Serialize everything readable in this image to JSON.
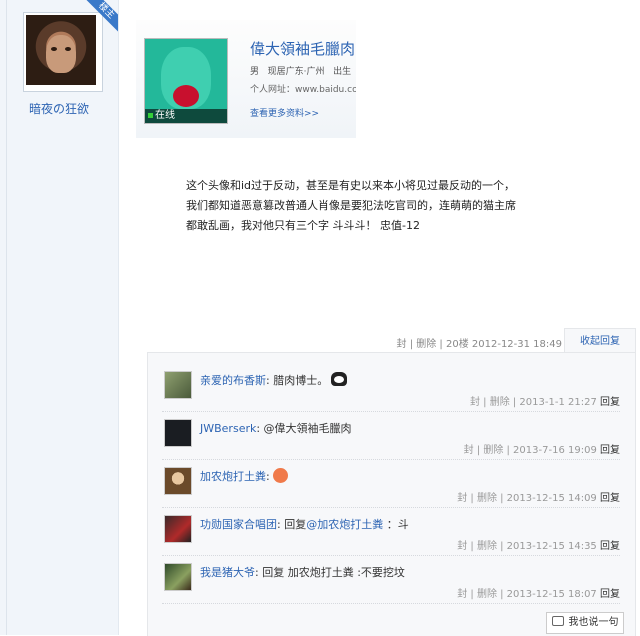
{
  "sidebar": {
    "badge": "楼主",
    "username": "暗夜の狂欲"
  },
  "card": {
    "name": "偉大領袖毛臘肉",
    "gender": "男",
    "location": "现居广东·广州",
    "extra": "出生",
    "url": "个人网址：www.baidu.co",
    "online": "在线",
    "more": "查看更多资料>>"
  },
  "post": {
    "text": "这个头像和id过于反动，甚至是有史以来本小将见过最反动的一个，我们都知道恶意篡改普通人肖像是要犯法吃官司的，连萌萌的猫主席都敢乱画，我对他只有三个字 斗斗斗！ 忠值-12",
    "meta": "封 | 删除 | 20楼  2012-12-31 18:49",
    "collapse": "收起回复"
  },
  "replies": [
    {
      "name": "亲爱的布香斯",
      "text": ": 腊肉博士。",
      "meta": "封 | 删除 | 2013-1-1 21:27",
      "reply": "回复"
    },
    {
      "name": "JWBerserk",
      "text": ": @偉大領袖毛臘肉",
      "meta": "封 | 删除 | 2013-7-16 19:09",
      "reply": "回复"
    },
    {
      "name": "加农炮打土粪",
      "text": ":",
      "meta": "封 | 删除 | 2013-12-15 14:09",
      "reply": "回复"
    },
    {
      "name": "功勋国家合唱团",
      "text_pre": ": 回复",
      "mention": "@加农炮打土粪",
      "text_post": " ：斗",
      "meta": "封 | 删除 | 2013-12-15 14:35",
      "reply": "回复"
    },
    {
      "name": "我是猪大爷",
      "text": ": 回复 加农炮打土粪 :不要挖坟",
      "meta": "封 | 删除 | 2013-12-15 18:07",
      "reply": "回复"
    }
  ],
  "say_button": "我也说一句",
  "icons": [
    "avatar-monkey",
    "avatar-mao",
    "panda-emoji-icon",
    "face-emoji-icon",
    "comment-icon"
  ]
}
